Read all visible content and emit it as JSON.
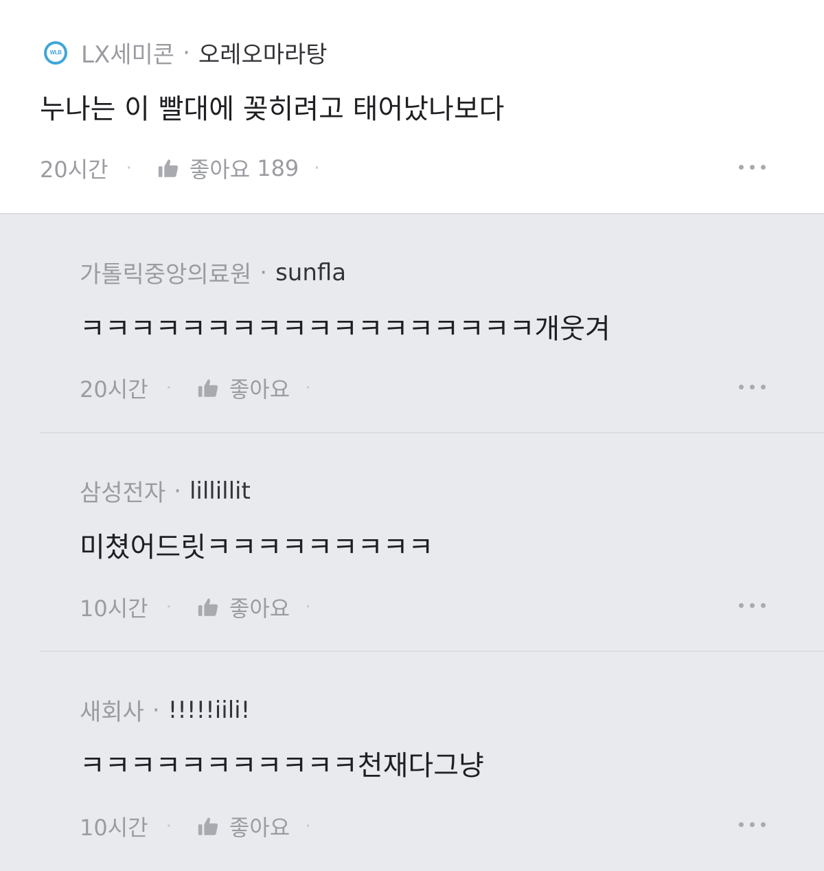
{
  "main": {
    "logo_text": "WLB",
    "company": "LX세미콘",
    "separator": "·",
    "nickname": "오레오마라탕",
    "text": "누나는 이 빨대에 꽂히려고 태어났나보다",
    "time": "20시간",
    "like_label": "좋아요",
    "like_count": "189"
  },
  "replies": [
    {
      "company": "가톨릭중앙의료원",
      "separator": "·",
      "nickname": "sunfla",
      "text": "ㅋㅋㅋㅋㅋㅋㅋㅋㅋㅋㅋㅋㅋㅋㅋㅋㅋㅋ개웃겨",
      "time": "20시간",
      "like_label": "좋아요"
    },
    {
      "company": "삼성전자",
      "separator": "·",
      "nickname": "lillillit",
      "text": "미쳤어드릿ㅋㅋㅋㅋㅋㅋㅋㅋㅋ",
      "time": "10시간",
      "like_label": "좋아요"
    },
    {
      "company": "새회사",
      "separator": "·",
      "nickname": "!!!!!iili!",
      "text": "ㅋㅋㅋㅋㅋㅋㅋㅋㅋㅋㅋ천재다그냥",
      "time": "10시간",
      "like_label": "좋아요"
    }
  ],
  "icons": {
    "logo": "wlb-logo-icon",
    "like": "thumbs-up-icon",
    "more": "more-dots-icon"
  },
  "colors": {
    "page_background": "#e9eaee",
    "main_background": "#ffffff",
    "logo_accent": "#3fa6d8",
    "muted_text": "#9b9ca1",
    "body_text": "#1e1f22"
  }
}
